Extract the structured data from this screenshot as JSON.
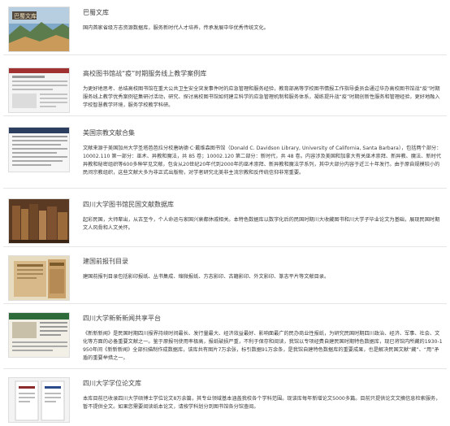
{
  "items": [
    {
      "title": "巴蜀文库",
      "description": "国内首家省级方志资源数据库，服务新时代人才培养，传承发展中华优秀传统文化。",
      "thumb_icon": "bashu-library-banner-image"
    },
    {
      "title": "高校图书馆战“疫”时期服务线上教学案例库",
      "description": "为更好地思考、总结高校图书馆在重大公共卫生安全突发事件时的应急管理和服务经验，教育部高等学校图书情报工作指导委员会通过华办高校图书馆战“疫”时期服务线上教学优秀案例征集研讨活动，研究、探讨高校图书馆如何建立科学的应急管理机制和服务体系，凝练提升战“疫”时期创新性服务和管理经验，更好地融入学校智慧教学环境，服务学校教学科研。",
      "thumb_icon": "website-screenshot-image"
    },
    {
      "title": "美国宗教文献合集",
      "description": "文献来源于美国加州大学圣塔芭芭拉分校唐纳德·C·戴维森图书馆（Donald C. Davidson Library, University of California, Santa Barbara），包括两个部分：10002.110 第一部分：巫术、异教和魔法，共 85 卷；10002.120 第二部分：新时代，共 48 卷。内容涉及美国和加拿大有关巫术崇拜、新异教、魔法、新时代异教和秘密组织等600多种罕见文献，包含从20世纪20年代到2000年的巫术崇拜、新异教和魔法学系列，其中大部分内容于近三十年发行。由于原自规模较小的民间宗教组织，这些文献大多为非正式出版物，对学者研究北美非主流宗教和反传统信仰非常重要。",
      "thumb_icon": "document-screenshot-image"
    },
    {
      "title": "四川大学图书馆民国文献数据库",
      "description": "起彩民国，大师辈出，从古至今，个人命运与家国兴衰都休戚相关。本特色数据库以数字化后的民国时期川大收藏图书和川大学子毕业论文为基础，展现民国时期文人风骨和人文关怀。",
      "thumb_icon": "old-books-image"
    },
    {
      "title": "建国前报刊目录",
      "description": "建国前报刊目录包括影印报纸、丛书集成、缩微报纸、方志影印、古籍影印、外文影印、篆志平片等文献目录。",
      "thumb_icon": "newspaper-stack-image"
    },
    {
      "title": "四川大学新新新闻共享平台",
      "description": "《新新新闻》是民国时期四川报界持续时间最长、发行量最大、经济效益最好、影响面最广的民办商业性报纸，为研究民国时期四川政治、经济、军事、社会、文化等方面的必备重要文献之一。鉴于原报刊使用率极高，报纸破损严重，不利于保存和阅读，我馆以专项经费自建民国时期特色数据库，现已将馆内所藏的1930-1950年间《新新新闻》全部扫描制作成数据库，该库共有图片7万余张，标引数据91万余条，是我馆自建特色数据库的重要成果，也是解决民国文献“藏”、“用”矛盾的重要举措之一。",
      "thumb_icon": "newspaper-page-image"
    },
    {
      "title": "四川大学学位论文库",
      "description": "本库目前已收录四川大学硕博士学位论文8万余篇，其专业领域基本涵盖我校各个学科范围。现该库每年新增论文5000多篇。目前只提供论文文摘信息检索服务，暂不提供全文。如果您需要阅读纸本论文，请按学科划分到图书馆各分馆查阅。",
      "thumb_icon": "thesis-cover-image"
    }
  ]
}
